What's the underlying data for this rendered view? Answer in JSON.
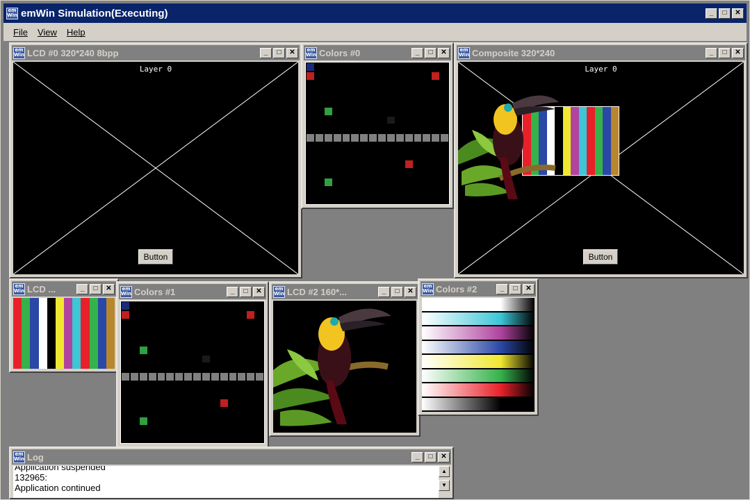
{
  "app": {
    "title": "emWin Simulation(Executing)"
  },
  "menu": [
    "File",
    "View",
    "Help"
  ],
  "icon_text": {
    "line1": "em",
    "line2": "Win"
  },
  "window_buttons": {
    "minimize": "_",
    "maximize": "□",
    "close": "✕"
  },
  "windows": {
    "lcd0": {
      "title": "LCD #0 320*240 8bpp",
      "layer_label": "Layer 0",
      "button_label": "Button"
    },
    "colors0": {
      "title": "Colors #0"
    },
    "composite": {
      "title": "Composite 320*240",
      "layer_label": "Layer 0",
      "button_label": "Button"
    },
    "lcd1": {
      "title": "LCD ..."
    },
    "colors1": {
      "title": "Colors #1"
    },
    "lcd2": {
      "title": "LCD #2 160*..."
    },
    "colors2": {
      "title": "Colors #2"
    },
    "log": {
      "title": "Log",
      "lines": [
        "Application suspended",
        "132965:",
        "Application continued"
      ]
    }
  },
  "colors": {
    "titlebar_active": "#0a246a",
    "titlebar_inactive": "#808080",
    "face": "#d4d0c8",
    "desktop": "#808080"
  },
  "color_bar": [
    "#e8202a",
    "#36b24a",
    "#2a48a6",
    "#ffffff",
    "#000000",
    "#f0e830",
    "#b044a0",
    "#3cc6d6",
    "#e8202a",
    "#36b24a",
    "#2a48a6",
    "#b8862c"
  ],
  "gradient_bars": [
    "#ffffff",
    "#3cc6d6",
    "#b044a0",
    "#2a48a6",
    "#f0e830",
    "#36b24a",
    "#e8202a",
    "#000000"
  ]
}
